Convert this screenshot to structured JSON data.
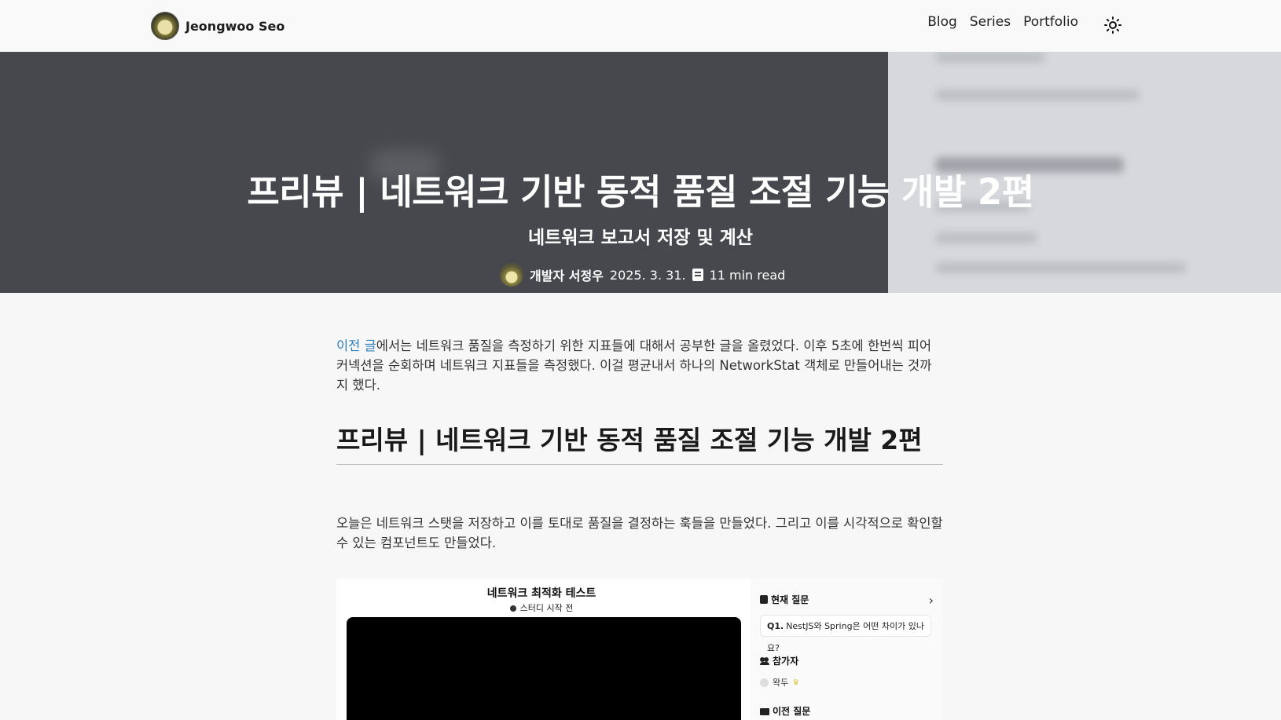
{
  "header": {
    "brand_name": "Jeongwoo Seo",
    "nav": [
      "Blog",
      "Series",
      "Portfolio"
    ],
    "theme_icon": "sun-icon"
  },
  "hero": {
    "title": "프리뷰 | 네트워크 기반 동적 품질 조절 기능 개발 2편",
    "subtitle": "네트워크 보고서 저장 및 계산",
    "author": "개발자 서정우",
    "date": "2025. 3. 31.",
    "read_time": "11 min read"
  },
  "article": {
    "intro_link": "이전 글",
    "intro_rest": "에서는 네트워크 품질을 측정하기 위한 지표들에 대해서 공부한 글을 올렸었다. 이후 5초에 한번씩 피어 커넥션을 순회하며 네트워크 지표들을 측정했다. 이걸 평균내서 하나의 NetworkStat 객체로 만들어내는 것까지 했다.",
    "heading": "프리뷰 | 네트워크 기반 동적 품질 조절 기능 개발 2편",
    "para2": "오늘은 네트워크 스탯을 저장하고 이를 토대로 품질을 결정하는 훅들을 만들었다. 그리고 이를 시각적으로 확인할 수 있는 컴포넌트도 만들었다."
  },
  "figure": {
    "title": "네트워크 최적화 테스트",
    "status": "스터디 시작 전",
    "current_question_label": "현재 질문",
    "question_number": "Q1.",
    "question_text": "NestJS와 Spring은 어떤 차이가 있나요?",
    "participants_label": "참가자",
    "participant_name": "왁두",
    "previous_questions_label": "이전 질문"
  },
  "colors": {
    "hero_bg": "#46484d",
    "link": "#2f7fb8"
  }
}
